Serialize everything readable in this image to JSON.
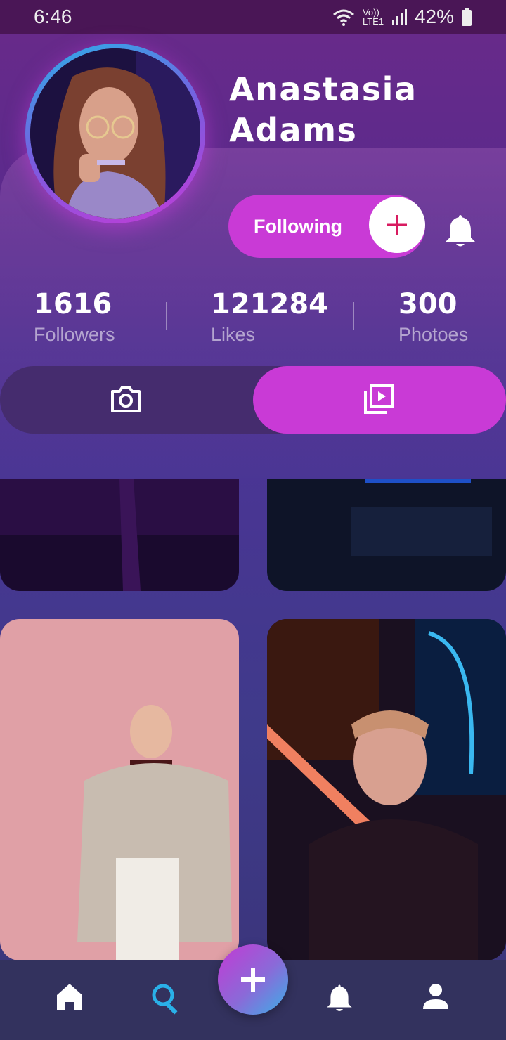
{
  "status_bar": {
    "time": "6:46",
    "network": "Vo)) LTE1",
    "battery": "42%"
  },
  "profile": {
    "first_name": "Anastasia",
    "last_name": "Adams"
  },
  "follow_button": {
    "label": "Following"
  },
  "stats": [
    {
      "value": "1616",
      "label": "Followers"
    },
    {
      "value": "121284",
      "label": "Likes"
    },
    {
      "value": "300",
      "label": "Photoes"
    }
  ],
  "tabs": {
    "active": "videos"
  },
  "icons": {
    "camera": "camera-icon",
    "video_library": "video-library-icon",
    "bell": "bell-icon",
    "plus": "plus-icon",
    "home": "home-icon",
    "search": "search-icon",
    "profile": "person-icon"
  },
  "colors": {
    "accent": "#c93ad6",
    "plus_red": "#d81b60",
    "search_blue": "#2ab0e8"
  }
}
